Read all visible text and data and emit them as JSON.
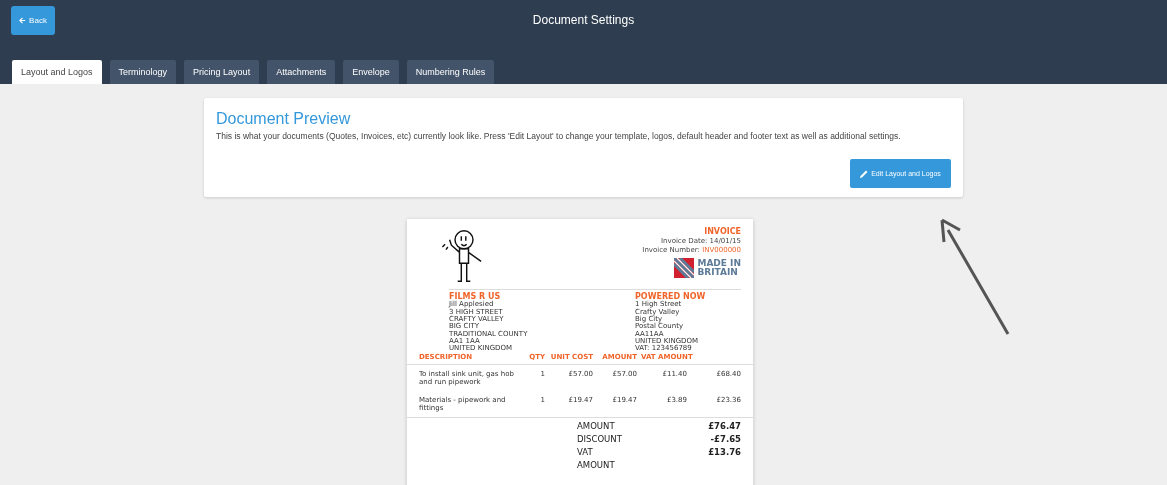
{
  "header": {
    "back_button": "Back",
    "title": "Document Settings"
  },
  "tabs": [
    {
      "label": "Layout and Logos",
      "selected": true
    },
    {
      "label": "Terminology",
      "selected": false
    },
    {
      "label": "Pricing Layout",
      "selected": false
    },
    {
      "label": "Attachments",
      "selected": false
    },
    {
      "label": "Envelope",
      "selected": false
    },
    {
      "label": "Numbering Rules",
      "selected": false
    }
  ],
  "preview_card": {
    "title": "Document Preview",
    "description": "This is what your documents (Quotes, Invoices, etc) currently look like. Press 'Edit Layout' to change your template, logos, default header and footer text as well as additional settings.",
    "button": "Edit Layout and Logos"
  },
  "document": {
    "doc_type": "INVOICE",
    "date_label": "Invoice Date:",
    "date": "14/01/15",
    "number_label": "Invoice Number:",
    "number": "INV000000",
    "badge_lines": [
      "MADE IN",
      "BRITAIN"
    ],
    "customer": {
      "name": "FILMS R US",
      "lines": [
        "Jill Applesied",
        "3 HIGH STREET",
        "CRAFTY VALLEY",
        "BIG CITY",
        "TRADITIONAL COUNTY",
        "AA1 1AA",
        "UNITED KINGDOM"
      ]
    },
    "company": {
      "name": "POWERED NOW",
      "lines": [
        "1 High Street",
        "Crafty Valley",
        "Big City",
        "Postal County",
        "AA11AA",
        "UNITED KINGDOM",
        "VAT: 123456789"
      ]
    },
    "columns": [
      "DESCRIPTION",
      "QTY",
      "UNIT COST",
      "AMOUNT",
      "VAT AMOUNT"
    ],
    "rows": [
      [
        "To install sink unit, gas hob and run pipework",
        "1",
        "£57.00",
        "£57.00",
        "£11.40",
        "£68.40"
      ],
      [
        "Materials - pipework and fittings",
        "1",
        "£19.47",
        "£19.47",
        "£3.89",
        "£23.36"
      ]
    ],
    "totals": [
      {
        "label": "AMOUNT",
        "value": "£76.47"
      },
      {
        "label": "DISCOUNT",
        "value": "-£7.65"
      },
      {
        "label": "VAT",
        "value": "£13.76"
      },
      {
        "label": "AMOUNT"
      }
    ]
  }
}
